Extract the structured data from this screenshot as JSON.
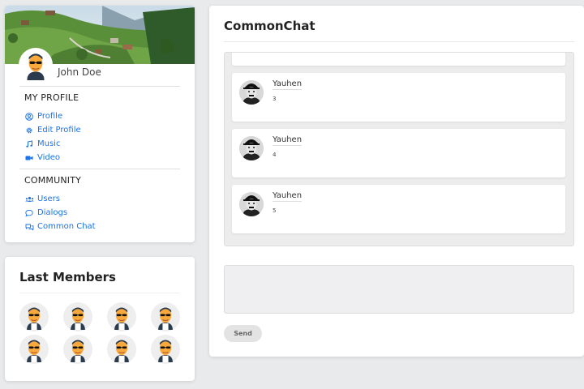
{
  "profile": {
    "name": "John Doe",
    "my_profile_title": "MY PROFILE",
    "my_profile_items": [
      {
        "label": "Profile",
        "icon": "user-circle-icon"
      },
      {
        "label": "Edit Profile",
        "icon": "gear-icon"
      },
      {
        "label": "Music",
        "icon": "music-note-icon"
      },
      {
        "label": "Video",
        "icon": "video-camera-icon"
      }
    ],
    "community_title": "COMMUNITY",
    "community_items": [
      {
        "label": "Users",
        "icon": "users-icon"
      },
      {
        "label": "Dialogs",
        "icon": "speech-bubble-icon"
      },
      {
        "label": "Common Chat",
        "icon": "chat-bubbles-icon"
      }
    ]
  },
  "members": {
    "title": "Last Members",
    "count": 8
  },
  "chat": {
    "title": "CommonChat",
    "messages": [
      {
        "author": "Yauhen",
        "text": "3"
      },
      {
        "author": "Yauhen",
        "text": "4"
      },
      {
        "author": "Yauhen",
        "text": "5"
      }
    ],
    "input_value": "",
    "send_label": "Send"
  },
  "colors": {
    "link": "#1a73e8",
    "avatar_skin": "#f9a83c",
    "avatar_hair": "#2b3b4e"
  }
}
